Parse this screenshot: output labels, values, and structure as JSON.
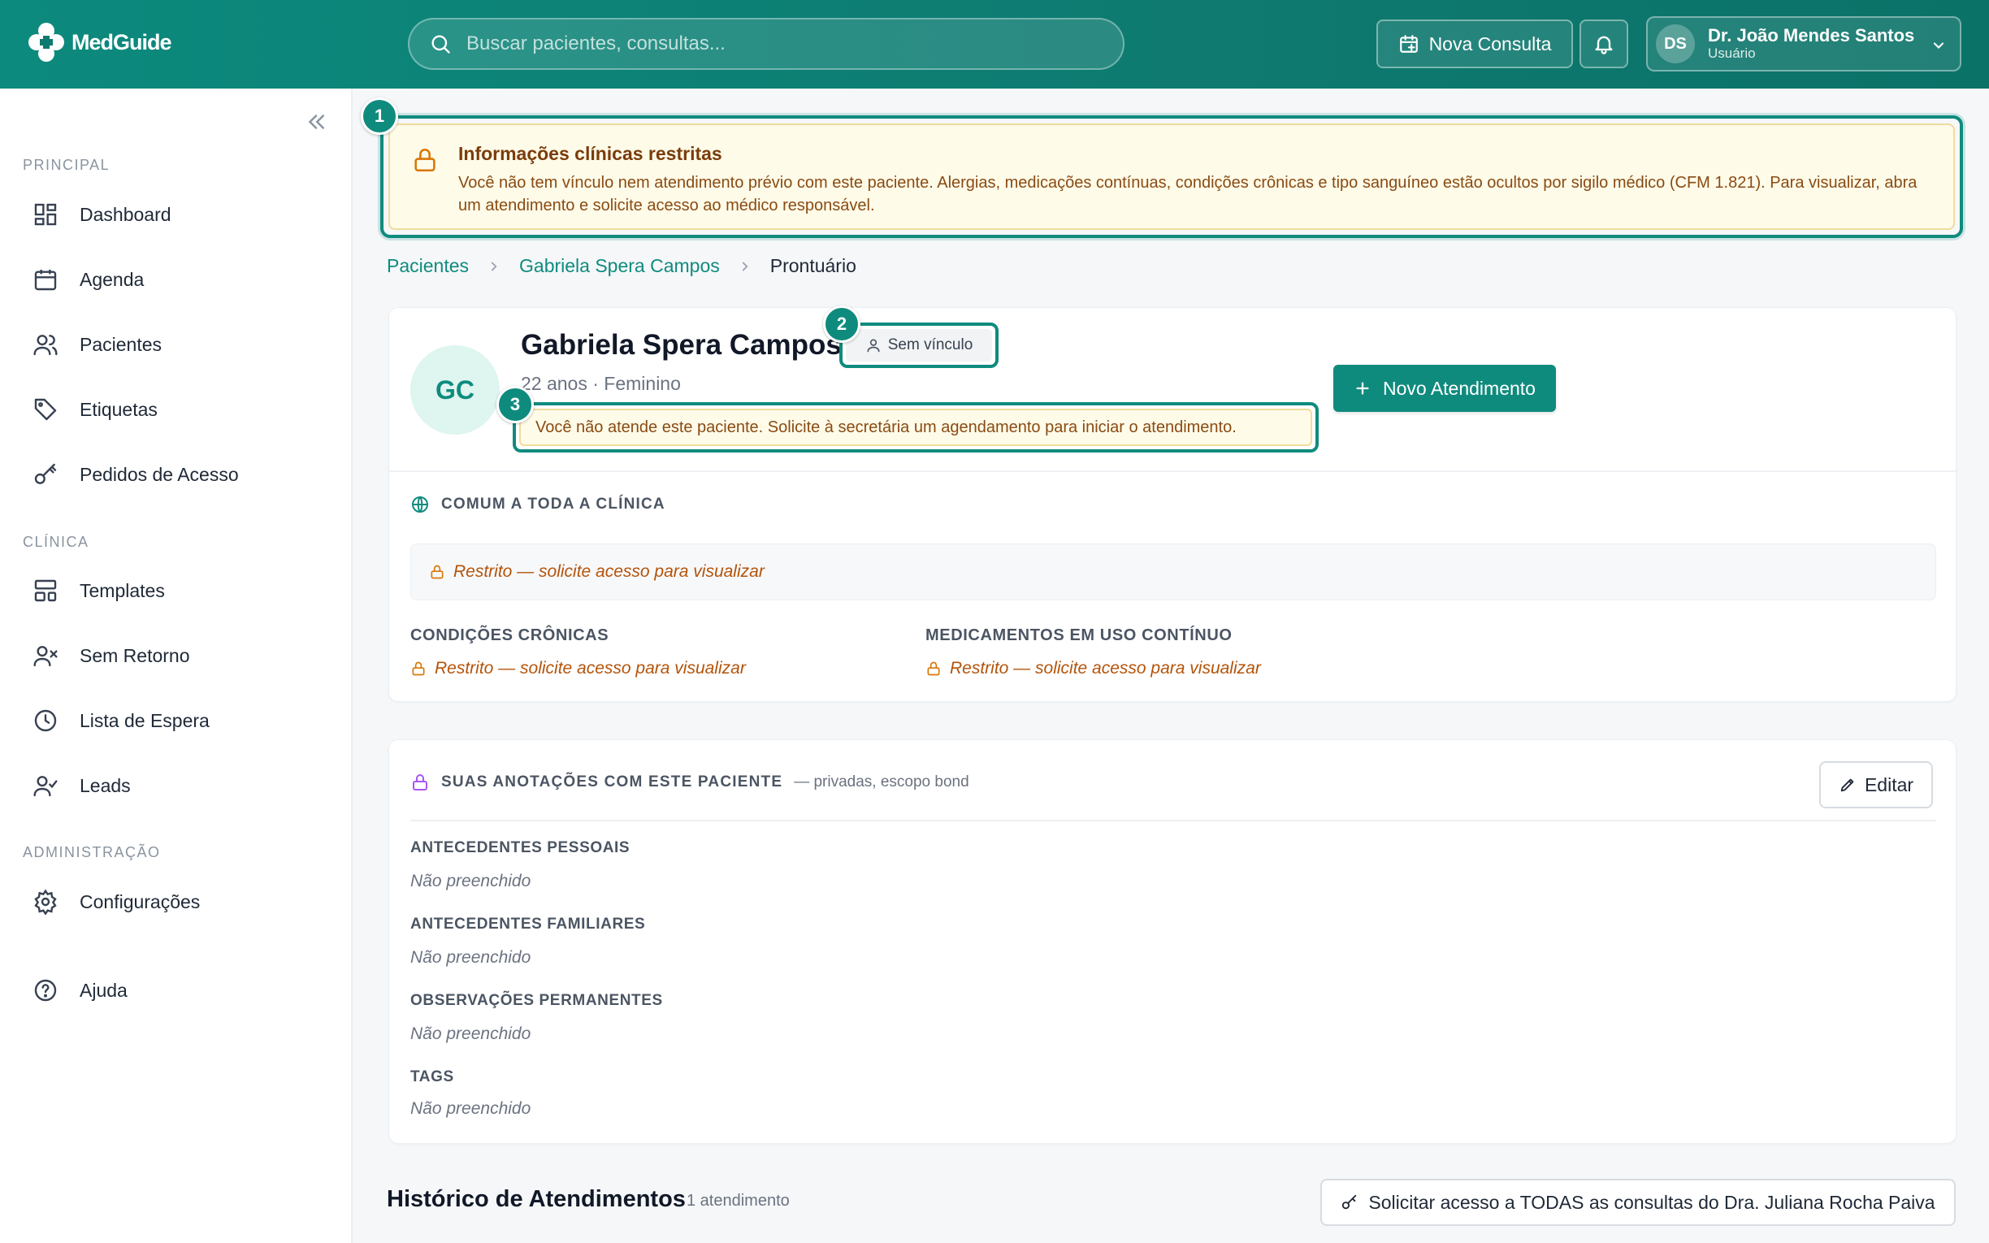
{
  "colors": {
    "brand": "#0f8b7e",
    "warning_bg": "#fefbe9",
    "warning_text": "#8a4b12",
    "restricted": "#b45309"
  },
  "header": {
    "logo_text": "MedGuide",
    "search_placeholder": "Buscar pacientes, consultas...",
    "new_consult_label": "Nova Consulta",
    "user_initials": "DS",
    "user_name": "Dr. João Mendes Santos",
    "user_role": "Usuário"
  },
  "sidebar": {
    "sections": [
      "PRINCIPAL",
      "CLÍNICA",
      "ADMINISTRAÇÃO"
    ],
    "items": [
      {
        "label": "Dashboard",
        "icon": "dashboard-icon"
      },
      {
        "label": "Agenda",
        "icon": "calendar-icon"
      },
      {
        "label": "Pacientes",
        "icon": "users-icon"
      },
      {
        "label": "Etiquetas",
        "icon": "tag-icon"
      },
      {
        "label": "Pedidos de Acesso",
        "icon": "key-icon"
      },
      {
        "label": "Templates",
        "icon": "template-icon"
      },
      {
        "label": "Sem Retorno",
        "icon": "user-x-icon"
      },
      {
        "label": "Lista de Espera",
        "icon": "clock-icon"
      },
      {
        "label": "Leads",
        "icon": "user-check-icon"
      },
      {
        "label": "Configurações",
        "icon": "gear-icon"
      },
      {
        "label": "Ajuda",
        "icon": "help-icon"
      }
    ]
  },
  "callouts": [
    "1",
    "2",
    "3"
  ],
  "alert": {
    "title": "Informações clínicas restritas",
    "text": "Você não tem vínculo nem atendimento prévio com este paciente. Alergias, medicações contínuas, condições crônicas e tipo sanguíneo estão ocultos por sigilo médico (CFM 1.821). Para visualizar, abra um atendimento e solicite acesso ao médico responsável."
  },
  "breadcrumb": [
    "Pacientes",
    "Gabriela Spera Campos",
    "Prontuário"
  ],
  "patient": {
    "initials": "GC",
    "name": "Gabriela Spera Campos",
    "link_badge": "Sem vínculo",
    "meta": "22 anos · Feminino",
    "notice": "Você não atende este paciente. Solicite à secretária um agendamento para iniciar o atendimento.",
    "new_attendance_label": "Novo Atendimento"
  },
  "clinic_section": {
    "title": "COMUM A TODA A CLÍNICA",
    "restricted_text": "Restrito — solicite acesso para visualizar",
    "chronic_label": "CONDIÇÕES CRÔNICAS",
    "chronic_value": "Restrito — solicite acesso para visualizar",
    "meds_label": "MEDICAMENTOS EM USO CONTÍNUO",
    "meds_value": "Restrito — solicite acesso para visualizar"
  },
  "notes_section": {
    "title": "SUAS ANOTAÇÕES COM ESTE PACIENTE",
    "subtitle": "— privadas, escopo bond",
    "edit_label": "Editar",
    "fields": [
      {
        "label": "ANTECEDENTES PESSOAIS",
        "value": "Não preenchido"
      },
      {
        "label": "ANTECEDENTES FAMILIARES",
        "value": "Não preenchido"
      },
      {
        "label": "OBSERVAÇÕES PERMANENTES",
        "value": "Não preenchido"
      },
      {
        "label": "TAGS",
        "value": "Não preenchido"
      }
    ]
  },
  "history": {
    "title": "Histórico de Atendimentos",
    "count": "1 atendimento",
    "request_all_label": "Solicitar acesso a TODAS as consultas do Dra. Juliana Rocha Paiva"
  }
}
